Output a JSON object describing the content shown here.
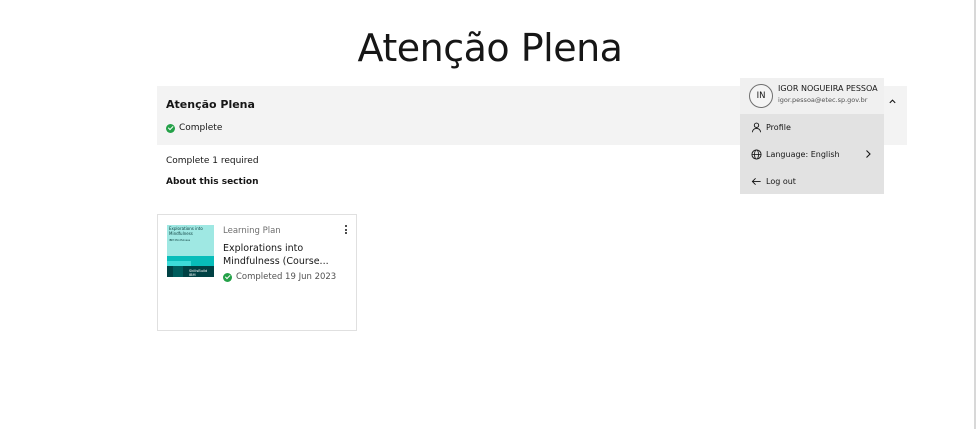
{
  "page": {
    "title": "Atenção Plena"
  },
  "section": {
    "title": "Atenção Plena",
    "status": "Complete",
    "requirement": "Complete 1 required",
    "about_label": "About this section"
  },
  "card": {
    "type": "Learning Plan",
    "title": "Explorations into Mindfulness (Course...",
    "status": "Completed 19 Jun 2023",
    "thumbnail": {
      "title": "Explorations into Mindfulness",
      "subtitle": "IBM Mindfulness",
      "logo": "SkillsBuild IBM"
    },
    "menu_icon": "overflow-menu-vertical-icon"
  },
  "user_menu": {
    "initials": "IN",
    "name": "IGOR NOGUEIRA PESSOA",
    "email": "igor.pessoa@etec.sp.gov.br",
    "items": [
      {
        "label": "Profile",
        "icon": "user-icon"
      },
      {
        "label": "Language: English",
        "icon": "globe-icon"
      },
      {
        "label": "Log out",
        "icon": "arrow-left-icon"
      }
    ]
  },
  "colors": {
    "success": "#24a148",
    "header_bg": "#f3f3f3",
    "menu_bg": "#e2e2e2",
    "thumbnail": "#9fe8e3"
  }
}
